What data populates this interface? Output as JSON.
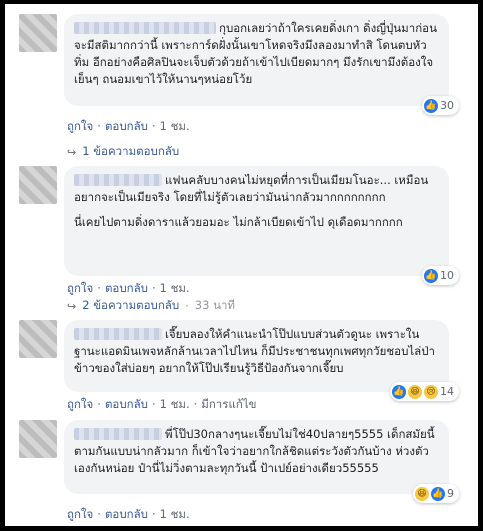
{
  "comments": [
    {
      "text": [
        "กุบอกเลยว่าถ้าใครเคยดิ่งเกา ดิ่งญี่ปุ่นมาก่อนจะมีสติมากกว่านี้ เพราะการ์ดฝั่งนั้นเขาโหดจริงมึงลองมาทำสิ โดนตบหัวทิ่ม อีกอย่างคือศิลปินจะเจ็บตัวด้วยถ้าเข้าไปเบียดมากๆ มึงรักเขามึงต้องใจเย็นๆ ถนอมเขาไว้ให้นานๆหน่อยโว้ย"
      ],
      "actions": [
        "ถูกใจ",
        "ตอบกลับ",
        "1 ชม."
      ],
      "reaction_count": "30",
      "reactions": [
        "like-icon"
      ],
      "replies_label": "1 ข้อความตอบกลับ",
      "replies_time": ""
    },
    {
      "text": [
        "แฟนคลับบางคนไม่หยุดที่การเป็นเมียมโนอะ... เหมือนอยากจะเป็นเมียจริง โดยที่ไม่รู้ตัวเลยว่ามันน่ากลัวมากกกกกกกก",
        "นี่เคยไปตามดิ่งดาราแล้วยอมอะ ไม่กล้าเบียดเข้าไป ดุเดือดมากกกก"
      ],
      "actions": [
        "ถูกใจ",
        "ตอบกลับ",
        "1 ชม."
      ],
      "reaction_count": "10",
      "reactions": [
        "like-icon"
      ],
      "replies_label": "2 ข้อความตอบกลับ",
      "replies_time": "33 นาที"
    },
    {
      "text": [
        "เจี๊ยบลองให้คำแนะนำโป๊ปแบบส่วนตัวดูนะ เพราะในฐานะแอดมินเพจหลักล้านเวลาไปไหน ก็มีประชาชนทุกเพศทุกวัยชอบไล่ป่าข้าวของใส่บ่อยๆ อยากให้โป๊ปเรียนรู้วิธีป้องกันจากเจี๊ยบ"
      ],
      "actions": [
        "ถูกใจ",
        "ตอบกลับ",
        "1 ชม.",
        "มีการแก้ไข"
      ],
      "reaction_count": "14",
      "reactions": [
        "like-icon",
        "haha-icon",
        "sad-icon"
      ],
      "replies_label": "",
      "replies_time": ""
    },
    {
      "text": [
        "พี่โป๊ป30กลางๆนะเจี๊ยบไม่ใช่40ปลายๆ5555 เด็กสมัยนี้ตามกันแบบน่ากลัวมาก ก็เข้าใจว่าอยากใกล้ชิดแต่ระวังตัวกันบ้าง ห่วงตัวเองกันหน่อย ป๋านี่ไม่วิ่งตามละทุกวันนี้ ป้าเปย์อย่างเดียว55555"
      ],
      "actions": [
        "ถูกใจ",
        "ตอบกลับ",
        "1 ชม."
      ],
      "reaction_count": "9",
      "reactions": [
        "haha-icon",
        "like-icon"
      ],
      "replies_label": "",
      "replies_time": ""
    }
  ]
}
